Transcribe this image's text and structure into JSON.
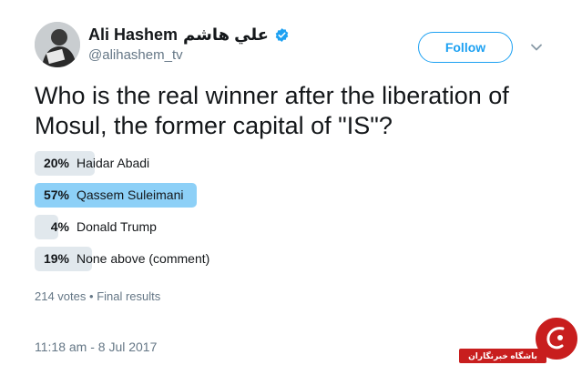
{
  "tweet": {
    "display_name": "Ali Hashem",
    "display_name_arabic": "علي هاشم",
    "handle": "@alihashem_tv",
    "verified": true,
    "follow_label": "Follow",
    "question": "Who is the real winner after the liberation of Mosul, the former capital of \"IS\"?",
    "timestamp": "11:18 am - 8 Jul 2017"
  },
  "poll": {
    "options": [
      {
        "percent_label": "20%",
        "percent": 20,
        "label": "Haidar Abadi",
        "leading": false
      },
      {
        "percent_label": "57%",
        "percent": 57,
        "label": "Qassem Suleimani",
        "leading": true
      },
      {
        "percent_label": "4%",
        "percent": 4,
        "label": "Donald Trump",
        "leading": false
      },
      {
        "percent_label": "19%",
        "percent": 19,
        "label": "None above (comment)",
        "leading": false
      }
    ],
    "votes_text": "214 votes",
    "separator": "•",
    "status_text": "Final results"
  },
  "watermark": {
    "text": "باشگاه خبرنگاران"
  },
  "colors": {
    "accent": "#1da1f2",
    "leading_bar": "#8dd0f7",
    "bar": "#e1e8ed",
    "secondary_text": "#657786",
    "watermark_red": "#c81e1e"
  },
  "icons": {
    "verified": "verified-badge-icon",
    "more": "chevron-down-icon"
  }
}
